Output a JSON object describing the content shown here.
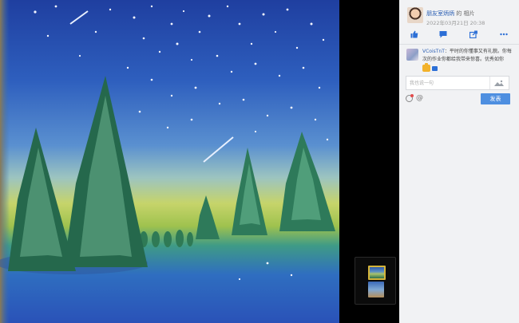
{
  "post": {
    "author": "朋友室炳炳",
    "connector": "的",
    "type_label": "相片",
    "timestamp": "2022年03月21日 20:38"
  },
  "actions": [
    {
      "name": "like-button",
      "icon": "thumbs-up-icon"
    },
    {
      "name": "comment-button",
      "icon": "comment-icon"
    },
    {
      "name": "share-button",
      "icon": "share-icon"
    },
    {
      "name": "more-button",
      "icon": "more-icon"
    }
  ],
  "comment": {
    "author": "VCoisTnT",
    "separator": "：",
    "text": "平时的你懂事又有礼貌。你每次的作业你都给我带来惊喜。优秀如你"
  },
  "reply_box": {
    "placeholder": "我也说一句",
    "send_label": "发表",
    "at_symbol": "@"
  },
  "colors": {
    "accent": "#4e8fe0",
    "link": "#2c5fb3",
    "panel_bg": "#f1f2f4",
    "highlight_thumb_border": "#d4b43a"
  }
}
